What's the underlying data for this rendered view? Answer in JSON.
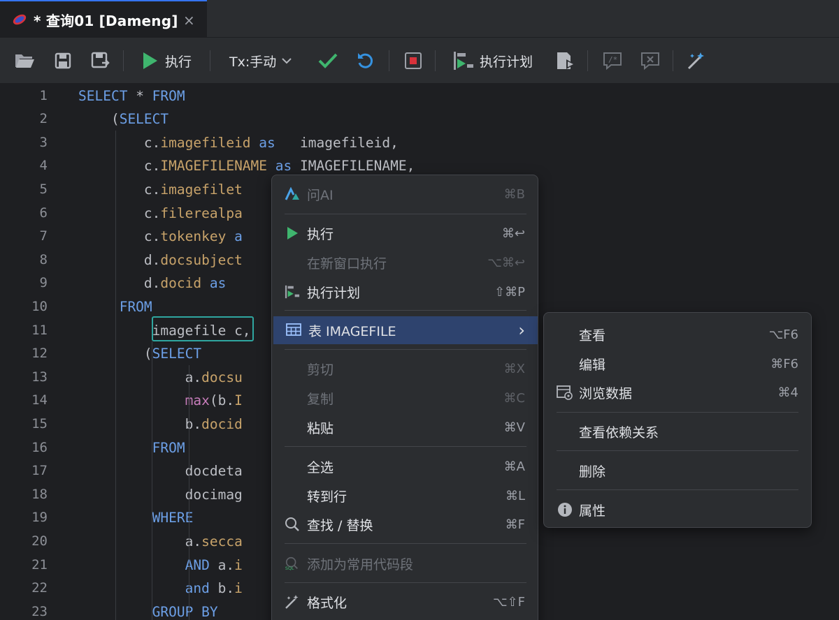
{
  "tab": {
    "title": "* 查询01 [Dameng]",
    "close": "×"
  },
  "toolbar": {
    "execute_label": "执行",
    "tx_label": "Tx:手动",
    "plan_label": "执行计划"
  },
  "editor": {
    "line_numbers": [
      "1",
      "2",
      "3",
      "4",
      "5",
      "6",
      "7",
      "8",
      "9",
      "10",
      "11",
      "12",
      "13",
      "14",
      "15",
      "16",
      "17",
      "18",
      "19",
      "20",
      "21",
      "22",
      "23"
    ],
    "lines": [
      [
        {
          "t": "SELECT ",
          "c": "kw"
        },
        {
          "t": "* ",
          "c": "plain"
        },
        {
          "t": "FROM",
          "c": "kw"
        }
      ],
      [
        {
          "t": "    (",
          "c": "plain"
        },
        {
          "t": "SELECT",
          "c": "kw"
        }
      ],
      [
        {
          "t": "        c.",
          "c": "plain"
        },
        {
          "t": "imagefileid",
          "c": "col"
        },
        {
          "t": " as ",
          "c": "kw"
        },
        {
          "t": "  imagefileid,",
          "c": "plain"
        }
      ],
      [
        {
          "t": "        c.",
          "c": "plain"
        },
        {
          "t": "IMAGEFILENAME",
          "c": "col"
        },
        {
          "t": " as ",
          "c": "kw"
        },
        {
          "t": "IMAGEFILENAME,",
          "c": "plain"
        }
      ],
      [
        {
          "t": "        c.",
          "c": "plain"
        },
        {
          "t": "imagefilet",
          "c": "col"
        }
      ],
      [
        {
          "t": "        c.",
          "c": "plain"
        },
        {
          "t": "filerealpa",
          "c": "col"
        }
      ],
      [
        {
          "t": "        c.",
          "c": "plain"
        },
        {
          "t": "tokenkey",
          "c": "col"
        },
        {
          "t": " a",
          "c": "kw"
        }
      ],
      [
        {
          "t": "        d.",
          "c": "plain"
        },
        {
          "t": "docsubject",
          "c": "col"
        }
      ],
      [
        {
          "t": "        d.",
          "c": "plain"
        },
        {
          "t": "docid",
          "c": "col"
        },
        {
          "t": " as",
          "c": "kw"
        }
      ],
      [
        {
          "t": "     ",
          "c": "plain"
        },
        {
          "t": "FROM",
          "c": "kw"
        }
      ],
      [
        {
          "t": "         imagefile ",
          "c": "plain"
        },
        {
          "t": "c,",
          "c": "plain"
        }
      ],
      [
        {
          "t": "        (",
          "c": "plain"
        },
        {
          "t": "SELECT",
          "c": "kw"
        }
      ],
      [
        {
          "t": "             a.",
          "c": "plain"
        },
        {
          "t": "docsu",
          "c": "col"
        }
      ],
      [
        {
          "t": "             ",
          "c": "plain"
        },
        {
          "t": "max",
          "c": "fn"
        },
        {
          "t": "(b.",
          "c": "plain"
        },
        {
          "t": "I",
          "c": "col"
        }
      ],
      [
        {
          "t": "             b.",
          "c": "plain"
        },
        {
          "t": "docid",
          "c": "col"
        }
      ],
      [
        {
          "t": "         ",
          "c": "plain"
        },
        {
          "t": "FROM",
          "c": "kw"
        }
      ],
      [
        {
          "t": "             docdeta",
          "c": "plain"
        }
      ],
      [
        {
          "t": "             docimag",
          "c": "plain"
        }
      ],
      [
        {
          "t": "         ",
          "c": "plain"
        },
        {
          "t": "WHERE",
          "c": "kw"
        }
      ],
      [
        {
          "t": "             a.",
          "c": "plain"
        },
        {
          "t": "secca",
          "c": "col"
        }
      ],
      [
        {
          "t": "             ",
          "c": "plain"
        },
        {
          "t": "AND",
          "c": "kw"
        },
        {
          "t": " a.",
          "c": "plain"
        },
        {
          "t": "i",
          "c": "col"
        }
      ],
      [
        {
          "t": "             ",
          "c": "plain"
        },
        {
          "t": "and",
          "c": "kw"
        },
        {
          "t": " b.",
          "c": "plain"
        },
        {
          "t": "i",
          "c": "col"
        }
      ],
      [
        {
          "t": "         ",
          "c": "plain"
        },
        {
          "t": "GROUP BY",
          "c": "kw"
        }
      ]
    ]
  },
  "context_menu": {
    "ask_ai": {
      "label": "问AI",
      "shortcut": "⌘B"
    },
    "execute": {
      "label": "执行",
      "shortcut": "⌘↩"
    },
    "execute_new_window": {
      "label": "在新窗口执行",
      "shortcut": "⌥⌘↩"
    },
    "execution_plan": {
      "label": "执行计划",
      "shortcut": "⇧⌘P"
    },
    "table": {
      "label": "表 IMAGEFILE",
      "arrow": "›"
    },
    "cut": {
      "label": "剪切",
      "shortcut": "⌘X"
    },
    "copy": {
      "label": "复制",
      "shortcut": "⌘C"
    },
    "paste": {
      "label": "粘贴",
      "shortcut": "⌘V"
    },
    "select_all": {
      "label": "全选",
      "shortcut": "⌘A"
    },
    "goto_line": {
      "label": "转到行",
      "shortcut": "⌘L"
    },
    "find_replace": {
      "label": "查找 / 替换",
      "shortcut": "⌘F"
    },
    "add_snippet": {
      "label": "添加为常用代码段",
      "shortcut": ""
    },
    "format": {
      "label": "格式化",
      "shortcut": "⌥⇧F"
    }
  },
  "submenu": {
    "view": {
      "label": "查看",
      "shortcut": "⌥F6"
    },
    "edit": {
      "label": "编辑",
      "shortcut": "⌘F6"
    },
    "browse": {
      "label": "浏览数据",
      "shortcut": "⌘4"
    },
    "deps": {
      "label": "查看依赖关系",
      "shortcut": ""
    },
    "delete": {
      "label": "删除",
      "shortcut": ""
    },
    "props": {
      "label": "属性",
      "shortcut": ""
    }
  },
  "colors": {
    "accent": "#3574f0",
    "selection": "#2e436e",
    "run_green": "#3fb56e",
    "highlight_teal": "#2fa6a0"
  }
}
